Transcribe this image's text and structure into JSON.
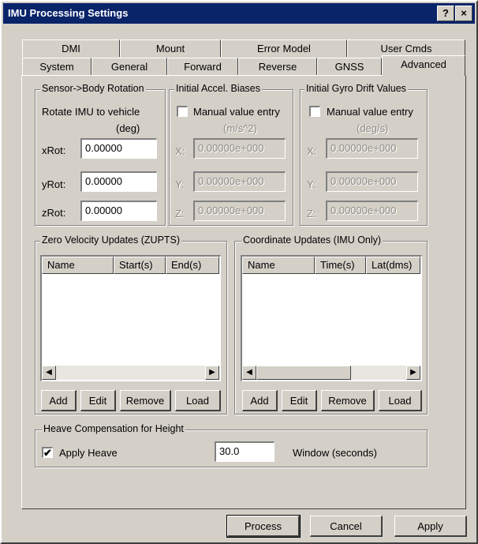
{
  "window": {
    "title": "IMU Processing Settings",
    "help_label": "?",
    "close_label": "×"
  },
  "tabs_back": [
    "DMI",
    "Mount",
    "Error Model",
    "User Cmds"
  ],
  "tabs_front": [
    "System",
    "General",
    "Forward",
    "Reverse",
    "GNSS",
    "Advanced"
  ],
  "sensor_rotation": {
    "title": "Sensor->Body Rotation",
    "desc_line1": "Rotate IMU to vehicle",
    "desc_line2": "(deg)",
    "x_label": "xRot:",
    "x_value": "0.00000",
    "y_label": "yRot:",
    "y_value": "0.00000",
    "z_label": "zRot:",
    "z_value": "0.00000"
  },
  "accel_biases": {
    "title": "Initial Accel. Biases",
    "checkbox_label": "Manual value entry",
    "units": "(m/s^2)",
    "x_label": "X:",
    "x_value": "0.00000e+000",
    "y_label": "Y:",
    "y_value": "0.00000e+000",
    "z_label": "Z:",
    "z_value": "0.00000e+000"
  },
  "gyro_drift": {
    "title": "Initial Gyro Drift Values",
    "checkbox_label": "Manual value entry",
    "units": "(deg/s)",
    "x_label": "X:",
    "x_value": "0.00000e+000",
    "y_label": "Y:",
    "y_value": "0.00000e+000",
    "z_label": "Z:",
    "z_value": "0.00000e+000"
  },
  "zupts": {
    "title": "Zero Velocity Updates (ZUPTS)",
    "columns": [
      "Name",
      "Start(s)",
      "End(s)"
    ],
    "buttons": [
      "Add",
      "Edit",
      "Remove",
      "Load"
    ]
  },
  "coord_updates": {
    "title": "Coordinate Updates (IMU Only)",
    "columns": [
      "Name",
      "Time(s)",
      "Lat(dms)"
    ],
    "buttons": [
      "Add",
      "Edit",
      "Remove",
      "Load"
    ]
  },
  "heave": {
    "title": "Heave Compensation for Height",
    "checkbox_label": "Apply Heave",
    "checked_mark": "✔",
    "window_value": "30.0",
    "window_label": "Window (seconds)"
  },
  "footer": {
    "process": "Process",
    "cancel": "Cancel",
    "apply": "Apply"
  }
}
